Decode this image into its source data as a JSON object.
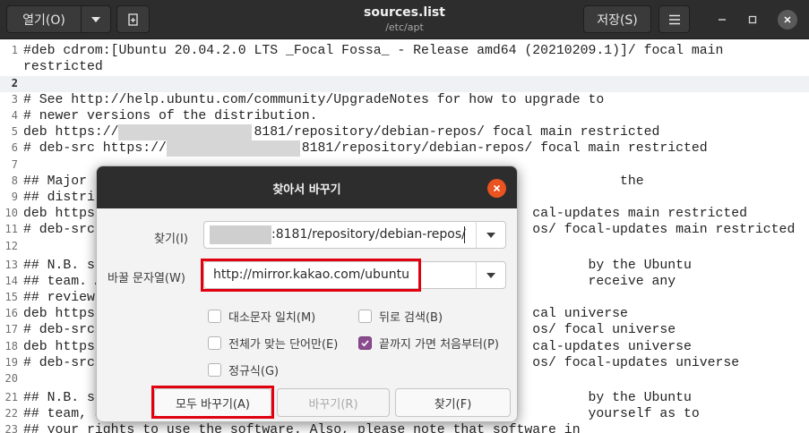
{
  "header": {
    "open_label": "열기(O)",
    "title": "sources.list",
    "subtitle": "/etc/apt",
    "save_label": "저장(S)"
  },
  "editor": {
    "lines": [
      {
        "n": "1",
        "text": "#deb cdrom:[Ubuntu 20.04.2.0 LTS _Focal Fossa_ - Release amd64 (20210209.1)]/ focal main"
      },
      {
        "n": "",
        "text": "restricted"
      },
      {
        "n": "2",
        "text": ""
      },
      {
        "n": "3",
        "text": "# See http://help.ubuntu.com/community/UpgradeNotes for how to upgrade to"
      },
      {
        "n": "4",
        "text": "# newer versions of the distribution."
      },
      {
        "n": "5",
        "text": "deb https://                :8181/repository/debian-repos/ focal main restricted"
      },
      {
        "n": "6",
        "text": "# deb-src https://                :8181/repository/debian-repos/ focal main restricted"
      },
      {
        "n": "7",
        "text": ""
      },
      {
        "n": "8",
        "text": "## Major                                                                   the"
      },
      {
        "n": "9",
        "text": "## distri"
      },
      {
        "n": "10",
        "text": "deb https                                                       cal-updates main restricted"
      },
      {
        "n": "11",
        "text": "# deb-src                                                       os/ focal-updates main restricted"
      },
      {
        "n": "12",
        "text": ""
      },
      {
        "n": "13",
        "text": "## N.B. s                                                              by the Ubuntu"
      },
      {
        "n": "14",
        "text": "## team. A                                                             receive any"
      },
      {
        "n": "15",
        "text": "## review"
      },
      {
        "n": "16",
        "text": "deb https                                                       cal universe"
      },
      {
        "n": "17",
        "text": "# deb-src                                                       os/ focal universe"
      },
      {
        "n": "18",
        "text": "deb https                                                       cal-updates universe"
      },
      {
        "n": "19",
        "text": "# deb-src                                                       os/ focal-updates universe"
      },
      {
        "n": "20",
        "text": ""
      },
      {
        "n": "21",
        "text": "## N.B. s                                                              by the Ubuntu"
      },
      {
        "n": "22",
        "text": "## team, a                                                             yourself as to"
      },
      {
        "n": "23",
        "text": "## your rights to use the software. Also, please note that software in"
      }
    ]
  },
  "dialog": {
    "title": "찾아서 바꾸기",
    "find_label": "찾기(I)",
    "find_value": ":8181/repository/debian-repos/",
    "replace_label": "바꿀 문자열(W)",
    "replace_value": "http://mirror.kakao.com/ubuntu",
    "options": {
      "match_case": {
        "label": "대소문자 일치(M)",
        "checked": false
      },
      "backwards": {
        "label": "뒤로 검색(B)",
        "checked": false
      },
      "whole_word": {
        "label": "전체가 맞는 단어만(E)",
        "checked": false
      },
      "wrap_around": {
        "label": "끝까지 가면 처음부터(P)",
        "checked": true
      },
      "regex": {
        "label": "정규식(G)",
        "checked": false
      }
    },
    "replace_all_label": "모두 바꾸기(A)",
    "replace_label_btn": "바꾸기(R)",
    "find_button_label": "찾기(F)"
  },
  "colors": {
    "accent": "#e95420",
    "checkbox_checked": "#8b4b8f",
    "highlight_frame": "#e00010",
    "headerbar": "#2d2d2d"
  }
}
